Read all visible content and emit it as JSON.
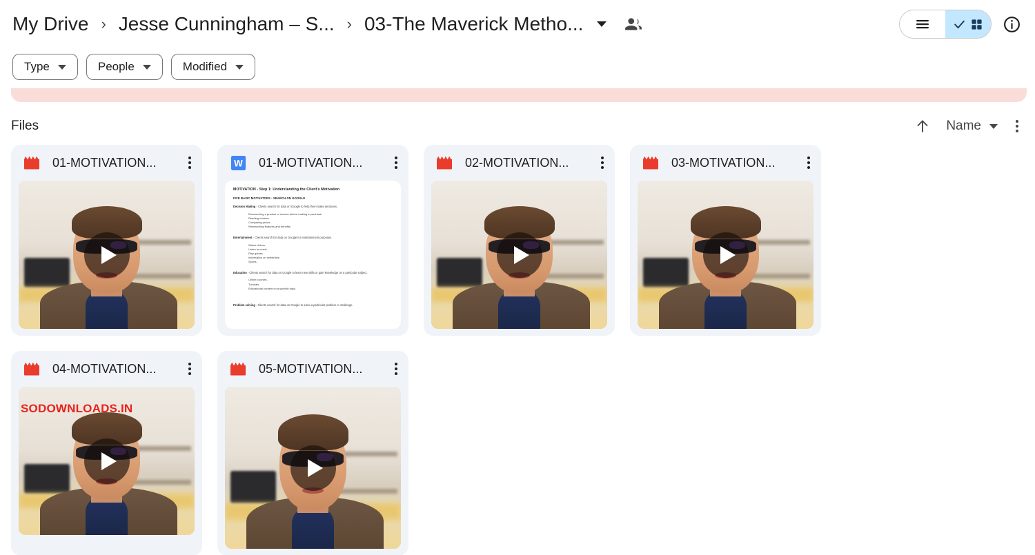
{
  "header": {
    "breadcrumb": [
      {
        "label": "My Drive"
      },
      {
        "label": "Jesse Cunningham – S..."
      },
      {
        "label": "03-The Maverick Metho..."
      }
    ],
    "separator": "›",
    "folder_caret_icon": "chevron-down-icon",
    "share_icon": "people-icon",
    "view_toggle": {
      "list_label": "list-view",
      "grid_label": "grid-view",
      "selected": "grid-view"
    },
    "info_icon": "info-circle-icon"
  },
  "filters": [
    {
      "label": "Type"
    },
    {
      "label": "People"
    },
    {
      "label": "Modified"
    }
  ],
  "banner": {
    "color": "#fadcd9"
  },
  "section": {
    "title": "Files",
    "sort_direction_icon": "arrow-up-icon",
    "sort_by_label": "Name",
    "overflow_icon": "more-vert-icon"
  },
  "files": [
    {
      "name": "01-MOTIVATION...",
      "icon": "video-clapperboard-icon",
      "type": "video",
      "watermark": "",
      "play_overlay": true
    },
    {
      "name": "01-MOTIVATION...",
      "icon": "word-doc-icon",
      "type": "document",
      "watermark": "",
      "play_overlay": false,
      "document": {
        "title_bold": "MOTIVATION",
        "title_rest": " - Step  1: Understanding the Client's Motivation",
        "subtitle": "FIVE BASIC MOTIVATORS - SEARCH ON GOOGLE",
        "sections": [
          {
            "lead": "Decision Making",
            "text": " - Clients search for data on Google to help them make decisions.",
            "items": [
              "Researching a product or service before making a purchase.",
              "Reading reviews.",
              "Comparing prices.",
              "Researching features and benefits."
            ]
          },
          {
            "lead": "Entertainment",
            "text": " - Clients search for data on Google for entertainment purposes.",
            "items": [
              "Watch videos.",
              "Listen to music.",
              "Play games.",
              "Information on celebrities.",
              "Sports."
            ]
          },
          {
            "lead": "Education",
            "text": " - Clients search for data on Google to learn new skills or gain knowledge on a particular subject.",
            "items": [
              "Online courses.",
              "Tutorials.",
              "Educational content on a specific topic."
            ]
          },
          {
            "lead": "Problem solving",
            "text": " - Clients search for data on Google to solve a particular problem or challenge.",
            "items": []
          }
        ]
      }
    },
    {
      "name": "02-MOTIVATION...",
      "icon": "video-clapperboard-icon",
      "type": "video",
      "watermark": "",
      "play_overlay": true
    },
    {
      "name": "03-MOTIVATION...",
      "icon": "video-clapperboard-icon",
      "type": "video",
      "watermark": "",
      "play_overlay": true
    },
    {
      "name": "04-MOTIVATION...",
      "icon": "video-clapperboard-icon",
      "type": "video",
      "watermark": "SODOWNLOADS.IN",
      "play_overlay": true
    },
    {
      "name": "05-MOTIVATION...",
      "icon": "video-clapperboard-icon",
      "type": "video",
      "watermark": "",
      "play_overlay": true
    }
  ],
  "colors": {
    "card_bg": "#f0f4f9",
    "video_icon": "#ea3c2d",
    "word_icon": "#4285f4",
    "selected_segment": "#c2e7ff",
    "banner": "#fadcd9",
    "watermark": "#e8231c"
  }
}
